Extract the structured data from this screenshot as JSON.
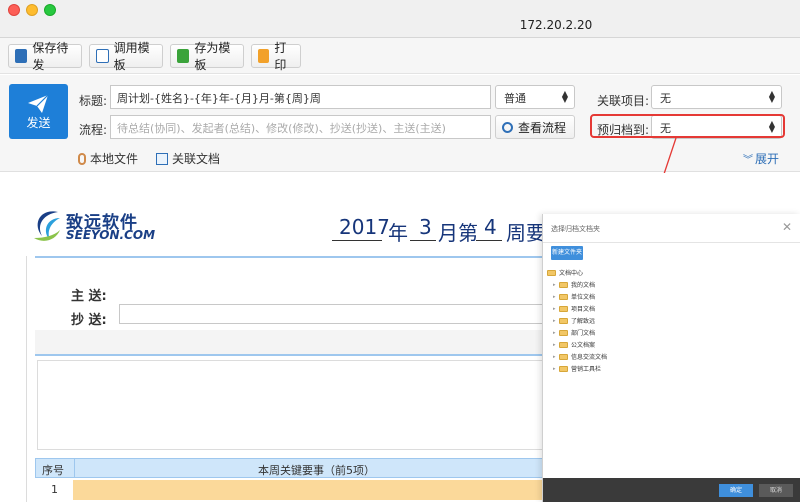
{
  "window": {
    "address": "172.20.2.20"
  },
  "toolbar": {
    "save_draft": "保存待发",
    "load_template": "调用模板",
    "save_template": "存为模板",
    "print": "打印"
  },
  "form": {
    "send": "发送",
    "title_label": "标题:",
    "title_value": "周计划-{姓名}-{年}年-{月}月-第{周}周",
    "priority": "普通",
    "related_project_label": "关联项目:",
    "related_project_value": "无",
    "flow_label": "流程:",
    "flow_placeholder": "待总结(协同)、发起者(总结)、修改(修改)、抄送(抄送)、主送(主送)",
    "view_flow": "查看流程",
    "archive_label": "预归档到:",
    "archive_value": "无",
    "local_file": "本地文件",
    "related_doc": "关联文档",
    "expand": "展开"
  },
  "document": {
    "logo_cn": "致远软件",
    "logo_en": "SEEYON.COM",
    "year": "2017",
    "year_unit": "年",
    "month": "3",
    "month_unit": "月第",
    "week": "4",
    "week_unit": "周要",
    "to_label": "主  送:",
    "cc_label": "抄  送:",
    "col_seq": "序号",
    "col_key": "本周关键要事（前5项）",
    "row1_seq": "1"
  },
  "dialog": {
    "title": "选择归档文档夹",
    "new_folder": "新建文件夹",
    "tree": [
      "文档中心",
      "我的文档",
      "单位文档",
      "项目文档",
      "了解致远",
      "部门文档",
      "公文档案",
      "信息交流文档",
      "营销工具栏"
    ],
    "ok": "确定",
    "cancel": "取消"
  },
  "colors": {
    "accent": "#1e7fd8",
    "highlight": "#e53935"
  }
}
